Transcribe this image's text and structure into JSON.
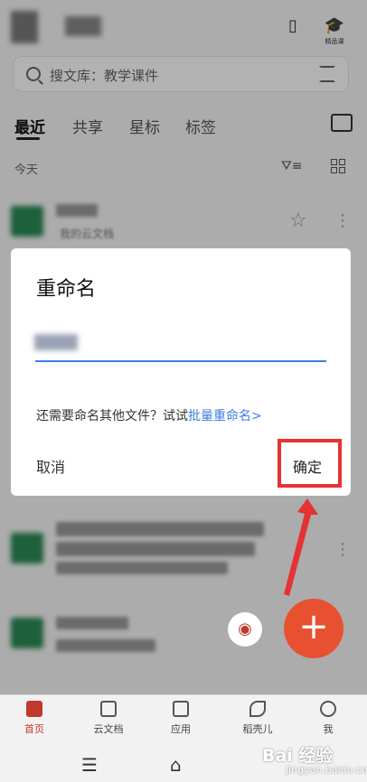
{
  "search": {
    "placeholder": "搜文库：教学课件"
  },
  "tabs": [
    "最近",
    "共享",
    "星标",
    "标签"
  ],
  "section_label": "今天",
  "file_location_blurred": "我的云文档",
  "header_icons": {
    "right_label": "精品课"
  },
  "dialog": {
    "title": "重命名",
    "hint": "还需要命名其他文件？试试",
    "hint_link": "批量重命名>",
    "cancel": "取消",
    "confirm": "确定"
  },
  "bottom_nav": [
    {
      "label": "首页",
      "icon": "home-icon",
      "active": true
    },
    {
      "label": "云文档",
      "icon": "cloud-doc-icon",
      "active": false
    },
    {
      "label": "应用",
      "icon": "apps-icon",
      "active": false
    },
    {
      "label": "稻壳儿",
      "icon": "leaf-icon",
      "active": false
    },
    {
      "label": "我",
      "icon": "person-icon",
      "active": false
    }
  ],
  "watermark": {
    "text": "Bai 经验",
    "sub": "jingyan.baidu.com"
  },
  "colors": {
    "accent": "#e8512f",
    "link": "#3d7be6",
    "highlight_box": "#e53333"
  }
}
